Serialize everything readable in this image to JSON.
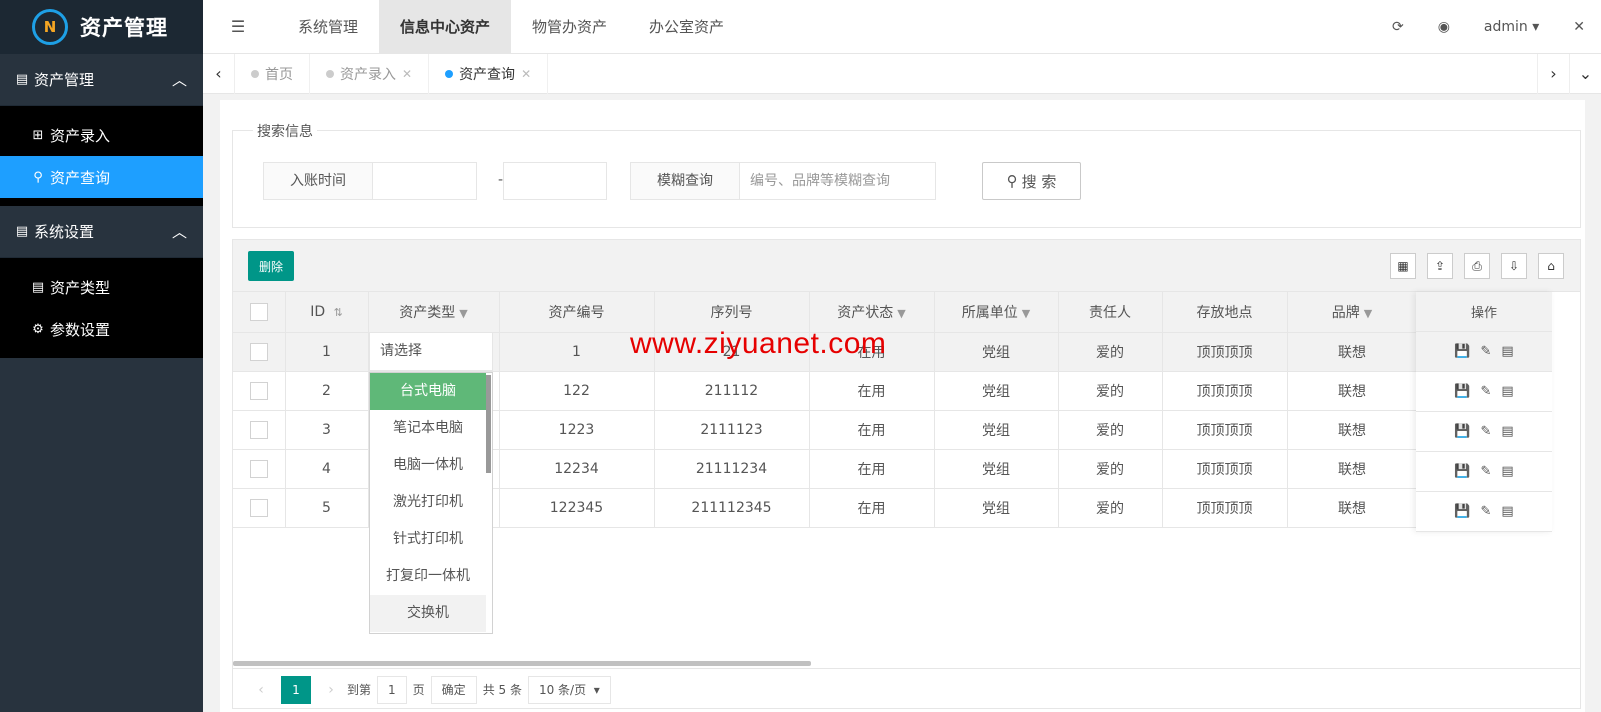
{
  "brand": {
    "logo_letter": "N",
    "title": "资产管理"
  },
  "sidebar": {
    "groups": [
      {
        "label": "资产管理",
        "items": [
          {
            "label": "资产录入"
          },
          {
            "label": "资产查询"
          }
        ]
      },
      {
        "label": "系统设置",
        "items": [
          {
            "label": "资产类型"
          },
          {
            "label": "参数设置"
          }
        ]
      }
    ]
  },
  "topnav": {
    "items": [
      "系统管理",
      "信息中心资产",
      "物管办资产",
      "办公室资产"
    ],
    "active": "信息中心资产",
    "user": "admin"
  },
  "tabs": [
    {
      "label": "首页"
    },
    {
      "label": "资产录入"
    },
    {
      "label": "资产查询"
    }
  ],
  "search": {
    "legend": "搜索信息",
    "date_label": "入账时间",
    "date_separator": "-",
    "fuzzy_label": "模糊查询",
    "fuzzy_placeholder": "编号、品牌等模糊查询",
    "button": "搜 索"
  },
  "toolbar": {
    "delete_label": "删除"
  },
  "table": {
    "headers": [
      "ID",
      "资产类型",
      "资产编号",
      "序列号",
      "资产状态",
      "所属单位",
      "责任人",
      "存放地点",
      "品牌",
      "操作"
    ],
    "rows": [
      {
        "id": "1",
        "type": "",
        "code": "1",
        "serial": "21",
        "status": "在用",
        "unit": "党组",
        "owner": "爱的",
        "location": "顶顶顶顶",
        "brand": "联想"
      },
      {
        "id": "2",
        "type": "",
        "code": "122",
        "serial": "211112",
        "status": "在用",
        "unit": "党组",
        "owner": "爱的",
        "location": "顶顶顶顶",
        "brand": "联想"
      },
      {
        "id": "3",
        "type": "",
        "code": "1223",
        "serial": "2111123",
        "status": "在用",
        "unit": "党组",
        "owner": "爱的",
        "location": "顶顶顶顶",
        "brand": "联想"
      },
      {
        "id": "4",
        "type": "",
        "code": "12234",
        "serial": "21111234",
        "status": "在用",
        "unit": "党组",
        "owner": "爱的",
        "location": "顶顶顶顶",
        "brand": "联想"
      },
      {
        "id": "5",
        "type": "",
        "code": "122345",
        "serial": "211112345",
        "status": "在用",
        "unit": "党组",
        "owner": "爱的",
        "location": "顶顶顶顶",
        "brand": "联想"
      }
    ]
  },
  "type_select": {
    "placeholder": "请选择",
    "options": [
      "台式电脑",
      "笔记本电脑",
      "电脑一体机",
      "激光打印机",
      "针式打印机",
      "打复印一体机",
      "交换机"
    ]
  },
  "pager": {
    "current": "1",
    "goto_label": "到第",
    "goto_value": "1",
    "page_unit": "页",
    "confirm": "确定",
    "total": "共 5 条",
    "page_size": "10 条/页"
  },
  "watermark": "www.ziyuanet.com"
}
